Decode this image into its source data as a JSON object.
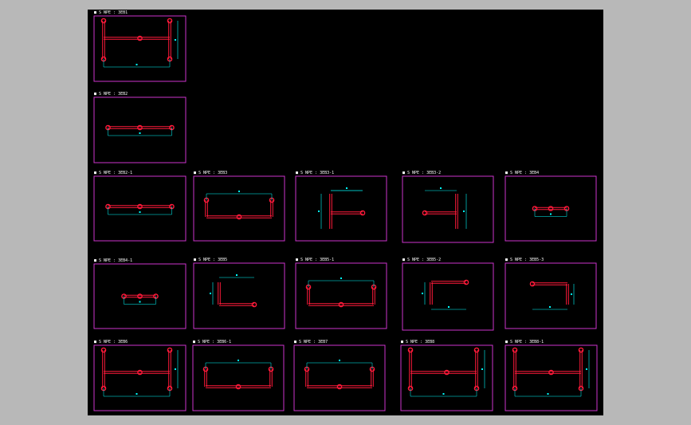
{
  "colors": {
    "page_bg": "#b8b8b8",
    "canvas_bg": "#000000",
    "frame": "#cc33cc",
    "beam": "#ff1a3a",
    "dim": "#00ffff",
    "label": "#ffffff"
  },
  "prefix": "■ S NPE : ",
  "panels": [
    {
      "key": "p1",
      "label": "3EB1",
      "shape": "H-tall"
    },
    {
      "key": "p2",
      "label": "3EB2",
      "shape": "flat"
    },
    {
      "key": "p3",
      "label": "3EB2-1",
      "shape": "flat"
    },
    {
      "key": "p4",
      "label": "3EB3",
      "shape": "U-up"
    },
    {
      "key": "p5",
      "label": "3EB3-1",
      "shape": "T-right"
    },
    {
      "key": "p6",
      "label": "3EB3-2",
      "shape": "T-left"
    },
    {
      "key": "p7",
      "label": "3EB4",
      "shape": "flat-short"
    },
    {
      "key": "p8",
      "label": "3EB4-1",
      "shape": "flat-short"
    },
    {
      "key": "p9",
      "label": "3EB5",
      "shape": "L-right"
    },
    {
      "key": "p10",
      "label": "3EB5-1",
      "shape": "U-up"
    },
    {
      "key": "p11",
      "label": "3EB5-2",
      "shape": "L-left"
    },
    {
      "key": "p12",
      "label": "3EB5-3",
      "shape": "L-rev"
    },
    {
      "key": "p13",
      "label": "3EB6",
      "shape": "H-wide"
    },
    {
      "key": "p14",
      "label": "3EB6-1",
      "shape": "U-up"
    },
    {
      "key": "p15",
      "label": "3EB7",
      "shape": "U-up"
    },
    {
      "key": "p16",
      "label": "3EB8",
      "shape": "H-wide"
    },
    {
      "key": "p17",
      "label": "3EB8-1",
      "shape": "H-wide"
    }
  ]
}
